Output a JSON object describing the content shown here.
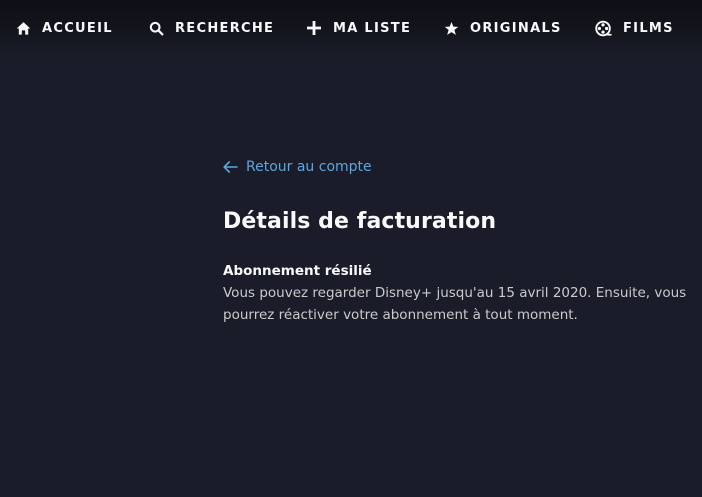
{
  "nav": {
    "items": [
      {
        "label": "ACCUEIL",
        "icon": "home-icon"
      },
      {
        "label": "RECHERCHE",
        "icon": "search-icon"
      },
      {
        "label": "MA LISTE",
        "icon": "plus-icon"
      },
      {
        "label": "ORIGINALS",
        "icon": "star-icon"
      },
      {
        "label": "FILMS",
        "icon": "film-reel-icon"
      }
    ]
  },
  "colors": {
    "background": "#1a1d29",
    "link": "#5ba6e0",
    "text": "#f9f9f9",
    "muted_text": "#cacaca"
  },
  "page": {
    "back_link": "Retour au compte",
    "title": "Détails de facturation",
    "status_heading": "Abonnement résilié",
    "status_text": "Vous pouvez regarder Disney+ jusqu'au 15 avril 2020. Ensuite, vous pourrez réactiver votre abonnement à tout moment."
  }
}
